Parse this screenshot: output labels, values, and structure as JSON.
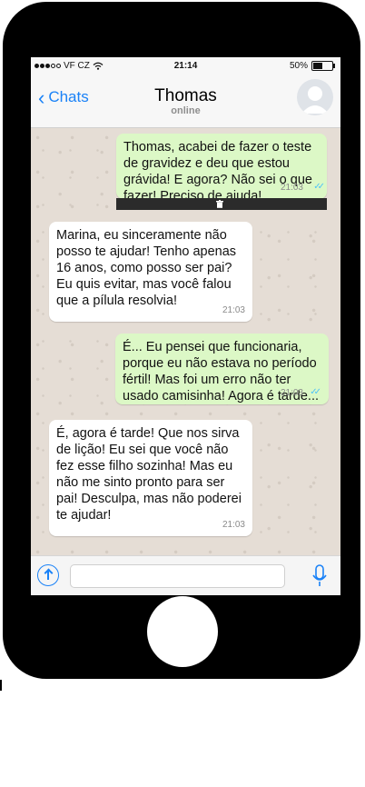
{
  "status_bar": {
    "carrier": "VF CZ",
    "time": "21:14",
    "battery": "50%",
    "battery_level": 0.5
  },
  "header": {
    "back_label": "Chats",
    "contact_name": "Thomas",
    "contact_status": "online"
  },
  "messages": [
    {
      "direction": "out",
      "text": "Thomas, acabei de fazer o teste de gravidez e deu que estou grávida! E agora? Não sei o que fazer! Preciso de ajuda!",
      "time": "21:03"
    },
    {
      "direction": "in",
      "text": "Marina, eu sinceramente não posso te ajudar! Tenho apenas 16 anos, como posso ser pai? Eu quis evitar, mas você falou que a pílula resolvia!",
      "time": "21:03"
    },
    {
      "direction": "out",
      "text": "É... Eu pensei que funcionaria, porque eu não estava no período fértil! Mas foi um erro não ter usado camisinha! Agora é tarde...",
      "time": "21:03"
    },
    {
      "direction": "in",
      "text": "É, agora é tarde! Que nos sirva de lição! Eu sei que você não fez esse filho sozinha! Mas eu não me sinto pronto para ser pai! Desculpa, mas não poderei te ajudar!",
      "time": "21:03"
    }
  ],
  "input": {
    "placeholder": ""
  },
  "colors": {
    "accent": "#1a82f7",
    "outgoing_bubble": "#dcf8c6",
    "incoming_bubble": "#ffffff",
    "chat_bg": "#e5ddd5",
    "read_ticks": "#4fc3f7"
  },
  "icons": [
    "signal-dots-icon",
    "wifi-icon",
    "battery-icon",
    "back-chevron-icon",
    "avatar-icon",
    "trash-icon",
    "read-ticks-icon",
    "upload-icon",
    "microphone-icon"
  ]
}
